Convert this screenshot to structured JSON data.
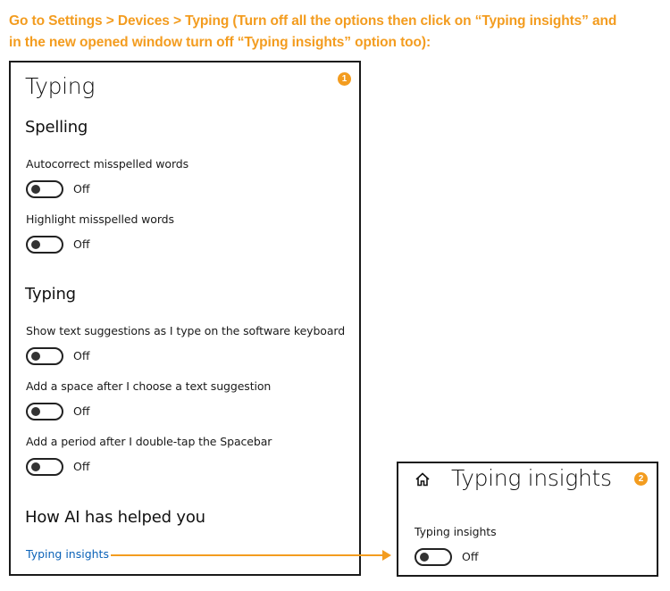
{
  "instruction": {
    "line1": "Go to Settings > Devices > Typing (Turn off all the options then click on “Typing insights” and",
    "line2": "in the new opened window turn off “Typing insights” option too):",
    "color": "#f39c1f"
  },
  "panel1": {
    "badge": "1",
    "title": "Typing",
    "sections": [
      {
        "heading": "Spelling",
        "settings": [
          {
            "label": "Autocorrect misspelled words",
            "state": "Off"
          },
          {
            "label": "Highlight misspelled words",
            "state": "Off"
          }
        ]
      },
      {
        "heading": "Typing",
        "settings": [
          {
            "label": "Show text suggestions as I type on the software keyboard",
            "state": "Off"
          },
          {
            "label": "Add a space after I choose a text suggestion",
            "state": "Off"
          },
          {
            "label": "Add a period after I double-tap the Spacebar",
            "state": "Off"
          }
        ]
      }
    ],
    "ai_heading": "How AI has helped you",
    "ai_link": "Typing insights",
    "link_color": "#0b62b8"
  },
  "panel2": {
    "badge": "2",
    "home_icon": "home-icon",
    "title": "Typing insights",
    "setting": {
      "label": "Typing insights",
      "state": "Off"
    }
  }
}
